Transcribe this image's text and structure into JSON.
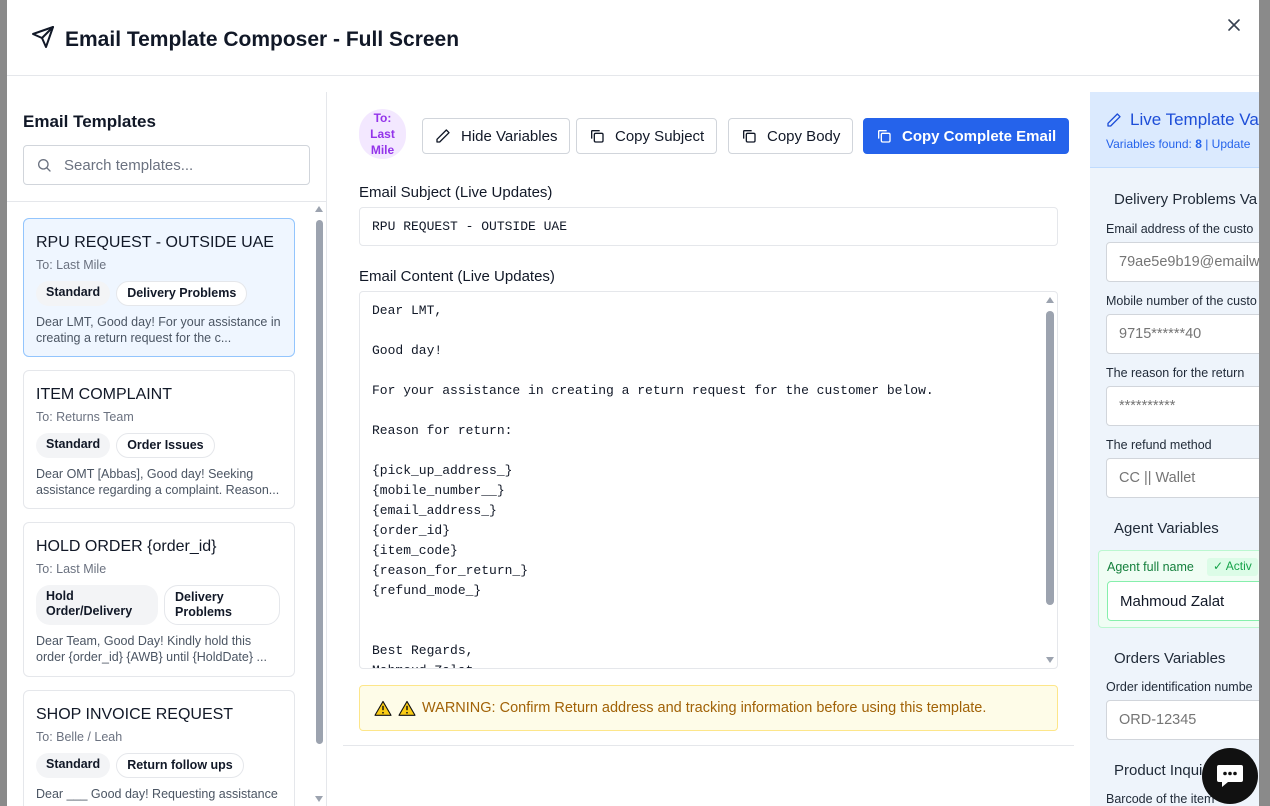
{
  "modal": {
    "title": "Email Template Composer - Full Screen"
  },
  "sidebar": {
    "title": "Email Templates",
    "search_placeholder": "Search templates...",
    "templates": [
      {
        "title": "RPU REQUEST - OUTSIDE UAE",
        "to": "To: Last Mile",
        "tags": [
          "Standard",
          "Delivery Problems"
        ],
        "preview": "Dear LMT, Good day! For your assistance in creating a return request for the c..."
      },
      {
        "title": "ITEM COMPLAINT",
        "to": "To: Returns Team",
        "tags": [
          "Standard",
          "Order Issues"
        ],
        "preview": "Dear OMT [Abbas], Good day! Seeking assistance regarding a complaint. Reason..."
      },
      {
        "title": "HOLD ORDER {order_id}",
        "to": "To: Last Mile",
        "tags": [
          "Hold Order/Delivery",
          "Delivery Problems"
        ],
        "preview": "Dear Team, Good Day! Kindly hold this order {order_id} {AWB} until {HoldDate} ..."
      },
      {
        "title": "SHOP INVOICE REQUEST",
        "to": "To: Belle / Leah",
        "tags": [
          "Standard",
          "Return follow ups"
        ],
        "preview": "Dear ___ Good day! Requesting assistance"
      }
    ]
  },
  "editor": {
    "to_badge": "To: Last Mile",
    "buttons": {
      "hide_variables": "Hide Variables",
      "copy_subject": "Copy Subject",
      "copy_body": "Copy Body",
      "copy_complete": "Copy Complete Email"
    },
    "subject_label": "Email Subject (Live Updates)",
    "subject_value": "RPU REQUEST - OUTSIDE UAE",
    "content_label": "Email Content (Live Updates)",
    "body": "Dear LMT,\n\nGood day!\n\nFor your assistance in creating a return request for the customer below.\n\nReason for return:\n\n{pick_up_address_}\n{mobile_number__}\n{email_address_}\n{order_id}\n{item_code}\n{reason_for_return_}\n{refund_mode_}\n\n\nBest Regards,\nMahmoud Zalat",
    "warning": "WARNING: Confirm Return address and tracking information before using this template."
  },
  "variables_panel": {
    "title": "Live Template Va",
    "found_label": "Variables found:",
    "found_count": "8",
    "found_suffix": "| Update",
    "sections": {
      "delivery": "Delivery Problems Va",
      "agent": "Agent Variables",
      "orders": "Orders Variables",
      "product": "Product Inqui"
    },
    "fields": {
      "email_label": "Email address of the custo",
      "email_value": "79ae5e9b19@emailw",
      "mobile_label": "Mobile number of the custo",
      "mobile_value": "9715******40",
      "reason_label": "The reason for the return",
      "reason_value": "**********",
      "refund_label": "The refund method",
      "refund_value": "CC || Wallet",
      "agent_label": "Agent full name",
      "agent_badge": "✓ Activ",
      "agent_value": "Mahmoud Zalat",
      "order_label": "Order identification numbe",
      "order_value": "ORD-12345",
      "barcode_label": "Barcode of the item"
    }
  },
  "colors": {
    "primary": "#2563eb",
    "purple_badge": "#9333ea",
    "warning_text": "#a16207",
    "green": "#15803d"
  }
}
